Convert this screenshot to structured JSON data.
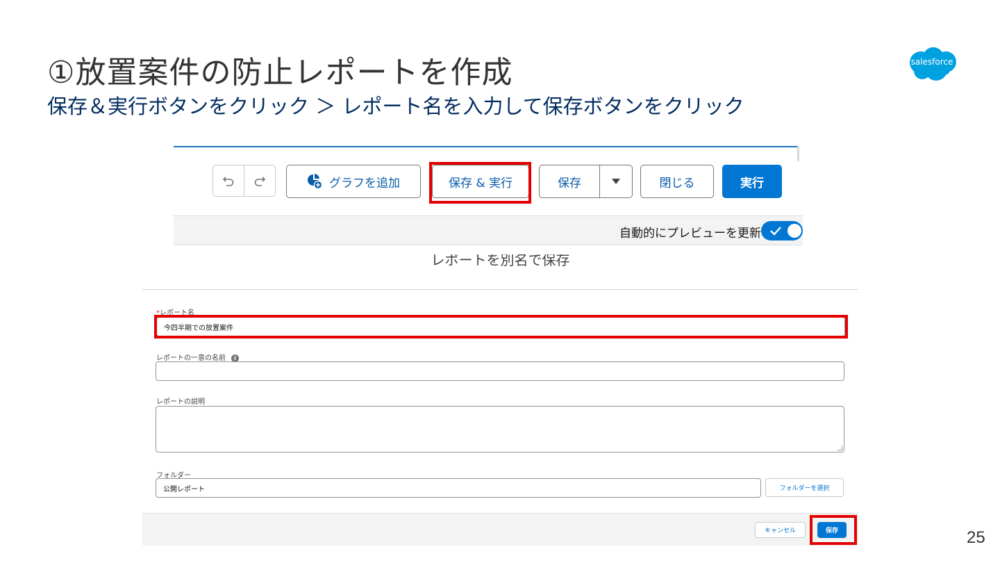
{
  "slide": {
    "title": "①放置案件の防止レポートを作成",
    "subtitle": "保存＆実行ボタンをクリック ＞ レポート名を入力して保存ボタンをクリック",
    "page_number": "25",
    "logo_text": "salesforce"
  },
  "toolbar": {
    "undo_icon": "undo-icon",
    "redo_icon": "redo-icon",
    "add_chart_label": "グラフを追加",
    "save_and_run_label": "保存 & 実行",
    "save_label": "保存",
    "save_menu_icon": "triangle-down-icon",
    "close_label": "閉じる",
    "run_label": "実行",
    "auto_preview_label": "自動的にプレビューを更新",
    "auto_preview_on": true
  },
  "dialog": {
    "title": "レポートを別名で保存",
    "report_name": {
      "label": "レポート名",
      "required_mark": "*",
      "value": "今四半期での放置案件"
    },
    "unique_name": {
      "label": "レポートの一意の名前",
      "value": ""
    },
    "description": {
      "label": "レポートの説明",
      "value": ""
    },
    "folder": {
      "label": "フォルダー",
      "value": "公開レポート",
      "select_button": "フォルダーを選択"
    },
    "cancel_label": "キャンセル",
    "save_label": "保存"
  },
  "colors": {
    "brand_blue": "#0176d3",
    "title_navy": "#032d60",
    "highlight_red": "#e30000"
  }
}
